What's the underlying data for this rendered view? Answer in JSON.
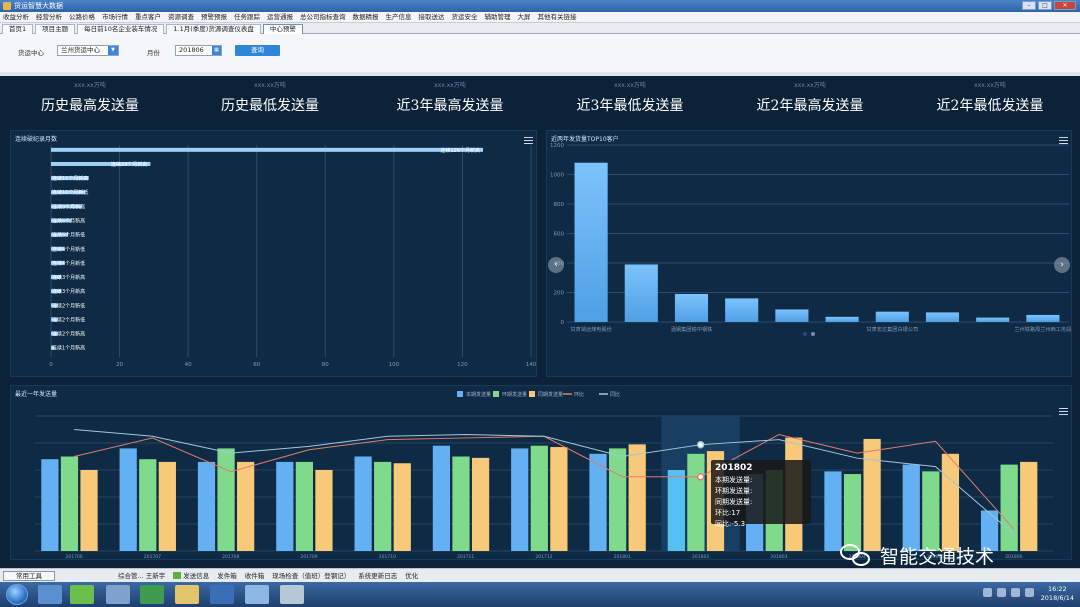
{
  "window": {
    "title": "货运智慧大数据"
  },
  "menu": [
    "收益分析",
    "经营分析",
    "公路价格",
    "市场行情",
    "重点客户",
    "资源调查",
    "预警预报",
    "任务跟踪",
    "运营通报",
    "总公司指标查询",
    "数据精报",
    "生产信息",
    "接取送达",
    "货运安全",
    "辅助管理",
    "大屏",
    "其他有关链接"
  ],
  "tabs": [
    "首页1",
    "项目主题",
    "每日前10名企业装车情况",
    "1.1月(季度)货源调查仪表盘",
    "中心预警"
  ],
  "filters": {
    "center_label": "货运中心",
    "center_value": "兰州货运中心",
    "month_label": "月份",
    "month_value": "201806",
    "query_label": "查询"
  },
  "kpis": [
    {
      "sub": "xxx.xx万吨",
      "label": "历史最高发送量"
    },
    {
      "sub": "xxx.xx万吨",
      "label": "历史最低发送量"
    },
    {
      "sub": "xxx.xx万吨",
      "label": "近3年最高发送量"
    },
    {
      "sub": "xxx.xx万吨",
      "label": "近3年最低发送量"
    },
    {
      "sub": "xxx.xx万吨",
      "label": "近2年最高发送量"
    },
    {
      "sub": "xxx.xx万吨",
      "label": "近2年最低发送量"
    }
  ],
  "panels": {
    "records_title": "连续破纪录月数",
    "top10_title": "近两年发货量TOP10客户",
    "trend_title": "最近一年发送量"
  },
  "chart_data": [
    {
      "type": "bar",
      "orientation": "horizontal",
      "title": "连续破纪录月数",
      "xlim": [
        0,
        140
      ],
      "x_ticks": [
        "0",
        "20",
        "40",
        "60",
        "80",
        "100",
        "120",
        "140"
      ],
      "bars": [
        {
          "value": 126,
          "label": "连续126个月新高"
        },
        {
          "value": 29,
          "label": "连续29个月新高"
        },
        {
          "value": 11,
          "label": "连续11个月新高"
        },
        {
          "value": 10,
          "label": "连续10个月新低"
        },
        {
          "value": 9,
          "label": "连续9个月新高"
        },
        {
          "value": 6,
          "label": "连续6个月新高"
        },
        {
          "value": 5,
          "label": "连续5个月新低"
        },
        {
          "value": 4,
          "label": "连续4个月新低"
        },
        {
          "value": 4,
          "label": "连续4个月新低"
        },
        {
          "value": 3,
          "label": "连续3个月新高"
        },
        {
          "value": 3,
          "label": "连续3个月新高"
        },
        {
          "value": 2,
          "label": "连续2个月新低"
        },
        {
          "value": 2,
          "label": "连续2个月新低"
        },
        {
          "value": 2,
          "label": "连续2个月新高"
        },
        {
          "value": 1,
          "label": "连续1个月新高"
        }
      ]
    },
    {
      "type": "bar",
      "title": "近两年发货量TOP10客户",
      "ylim": [
        0,
        1200
      ],
      "y_ticks": [
        "0",
        "200",
        "400",
        "600",
        "800",
        "1000",
        "1200"
      ],
      "categories": [
        "甘肃靖远煤电股份",
        "",
        "酒钢集团榆中钢铁",
        "",
        "",
        "",
        "甘肃宏达集团白银公司",
        "",
        "",
        "兰州铁路局兰州西工务段"
      ],
      "values": [
        1080,
        390,
        190,
        160,
        85,
        35,
        70,
        65,
        30,
        48
      ]
    },
    {
      "type": "bar",
      "title": "最近一年发送量",
      "legend": [
        "本期发送量",
        "环期发送量",
        "同期发送量",
        "环比",
        "同比"
      ],
      "legend_position": "top-center",
      "categories": [
        "201706",
        "201707",
        "201708",
        "201709",
        "201710",
        "201711",
        "201712",
        "201801",
        "201802",
        "201803",
        "201804",
        "201805",
        "201806"
      ],
      "ylim": [
        0,
        100
      ],
      "y2lim": [
        0,
        0.8
      ],
      "series": [
        {
          "name": "本期发送量",
          "values": [
            68,
            76,
            66,
            66,
            70,
            78,
            76,
            72,
            60,
            57,
            59,
            64,
            30
          ]
        },
        {
          "name": "环期发送量",
          "values": [
            70,
            68,
            76,
            66,
            66,
            70,
            78,
            76,
            72,
            60,
            57,
            59,
            64
          ]
        },
        {
          "name": "同期发送量",
          "values": [
            60,
            66,
            66,
            60,
            65,
            69,
            77,
            79,
            74,
            84,
            83,
            72,
            66
          ]
        },
        {
          "name": "环比",
          "values": [
            0.56,
            0.67,
            0.47,
            0.6,
            0.66,
            0.67,
            0.68,
            0.44,
            0.44,
            0.69,
            0.58,
            0.65,
            0.13
          ]
        },
        {
          "name": "同比",
          "values": [
            0.72,
            0.68,
            0.58,
            0.62,
            0.68,
            0.69,
            0.68,
            0.56,
            0.63,
            0.66,
            0.55,
            0.5,
            0.1
          ]
        }
      ],
      "colors": [
        "#63b0f3",
        "#7fdb8b",
        "#f8c978",
        "#e07b6f",
        "#9fc8d9"
      ],
      "highlight_category": "201802"
    }
  ],
  "tooltip": {
    "title": "201802",
    "rows": [
      "本期发送量:",
      "环期发送量:",
      "同期发送量:",
      "环比:17",
      "同比:-5.3"
    ]
  },
  "statusbar": {
    "common_tools": "常用工具",
    "items": [
      "综合管... 王新宇",
      "发送信息",
      "发件箱",
      "收件箱",
      "现场检查（值班）登钢记）",
      "系统更新日志",
      "优化"
    ]
  },
  "taskbar": {
    "time": "16:22",
    "date": "2018/6/14"
  },
  "watermark": {
    "text": "智能交通技术"
  }
}
